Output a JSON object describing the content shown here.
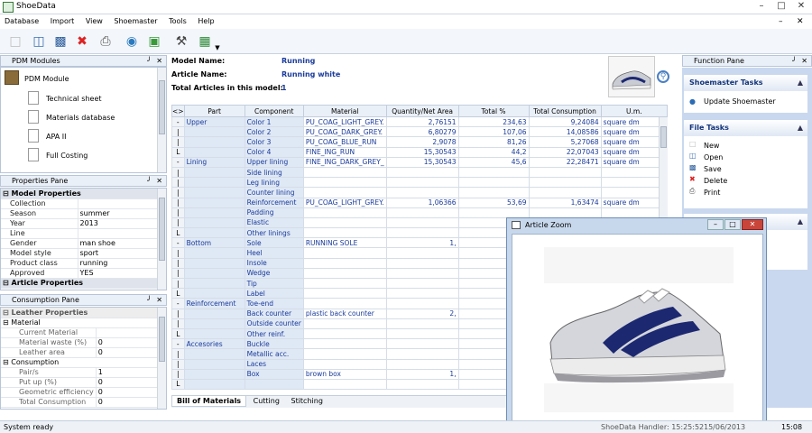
{
  "app": {
    "title": "ShoeData"
  },
  "menu": [
    "Database",
    "Import",
    "View",
    "Shoemaster",
    "Tools",
    "Help"
  ],
  "pdm": {
    "title": "PDM Modules",
    "root": "PDM Module",
    "items": [
      "Technical sheet",
      "Materials database",
      "APA II",
      "Full Costing"
    ]
  },
  "properties": {
    "title": "Properties Pane",
    "section1": "Model Properties",
    "rows": [
      [
        "Collection",
        ""
      ],
      [
        "Season",
        "summer"
      ],
      [
        "Year",
        "2013"
      ],
      [
        "Line",
        ""
      ],
      [
        "Gender",
        "man shoe"
      ],
      [
        "Model style",
        "sport"
      ],
      [
        "Product class",
        "running"
      ],
      [
        "Approved",
        "YES"
      ]
    ],
    "section2": "Article Properties"
  },
  "consumption": {
    "title": "Consumption Pane",
    "section": "Leather Properties",
    "groups": [
      {
        "name": "Material",
        "rows": [
          [
            "Current Material",
            ""
          ],
          [
            "Material waste (%)",
            "0"
          ],
          [
            "Leather area",
            "0"
          ]
        ]
      },
      {
        "name": "Consumption",
        "rows": [
          [
            "Pair/s",
            "1"
          ],
          [
            "Put up (%)",
            "0"
          ],
          [
            "Geometric efficiency",
            "0"
          ],
          [
            "Total Consumption",
            "0"
          ]
        ]
      }
    ]
  },
  "model": {
    "name_label": "Model Name:",
    "name": "Running",
    "article_label": "Article Name:",
    "article": "Running white",
    "total_label": "Total Articles in this model:",
    "total": "1"
  },
  "bom": {
    "corner": "<>",
    "headers": [
      "Part",
      "Component",
      "Material",
      "Quantity/Net Area",
      "Total %",
      "Total Consumption",
      "U.m."
    ],
    "rows": [
      [
        "-",
        "Upper",
        "Color 1",
        "PU_COAG_LIGHT_GREY.",
        "2,76151",
        "234,63",
        "9,24084",
        "square dm"
      ],
      [
        "|",
        "",
        "Color 2",
        "PU_COAG_DARK_GREY.",
        "6,80279",
        "107,06",
        "14,08586",
        "square dm"
      ],
      [
        "|",
        "",
        "Color 3",
        "PU_COAG_BLUE_RUN",
        "2,9078",
        "81,26",
        "5,27068",
        "square dm"
      ],
      [
        "L",
        "",
        "Color 4",
        "FINE_ING_RUN",
        "15,30543",
        "44,2",
        "22,07043",
        "square dm"
      ],
      [
        "-",
        "Lining",
        "Upper lining",
        "FINE_ING_DARK_GREY_",
        "15,30543",
        "45,6",
        "22,28471",
        "square dm"
      ],
      [
        "|",
        "",
        "Side lining",
        "",
        "",
        "",
        "",
        ""
      ],
      [
        "|",
        "",
        "Leg lining",
        "",
        "",
        "",
        "",
        ""
      ],
      [
        "|",
        "",
        "Counter lining",
        "",
        "",
        "",
        "",
        ""
      ],
      [
        "|",
        "",
        "Reinforcement",
        "PU_COAG_LIGHT_GREY.",
        "1,06366",
        "53,69",
        "1,63474",
        "square dm"
      ],
      [
        "|",
        "",
        "Padding",
        "",
        "",
        "",
        "",
        ""
      ],
      [
        "|",
        "",
        "Elastic",
        "",
        "",
        "",
        "",
        ""
      ],
      [
        "L",
        "",
        "Other linings",
        "",
        "",
        "",
        "",
        ""
      ],
      [
        "-",
        "Bottom",
        "Sole",
        "RUNNING SOLE",
        "1,",
        "",
        "",
        ""
      ],
      [
        "|",
        "",
        "Heel",
        "",
        "",
        "",
        "",
        ""
      ],
      [
        "|",
        "",
        "Insole",
        "",
        "",
        "",
        "",
        ""
      ],
      [
        "|",
        "",
        "Wedge",
        "",
        "",
        "",
        "",
        ""
      ],
      [
        "|",
        "",
        "Tip",
        "",
        "",
        "",
        "",
        ""
      ],
      [
        "L",
        "",
        "Label",
        "",
        "",
        "",
        "",
        ""
      ],
      [
        "-",
        "Reinforcement",
        "Toe-end",
        "",
        "",
        "",
        "",
        ""
      ],
      [
        "|",
        "",
        "Back counter",
        "plastic back counter",
        "2,",
        "",
        "",
        ""
      ],
      [
        "|",
        "",
        "Outside counter",
        "",
        "",
        "",
        "",
        ""
      ],
      [
        "L",
        "",
        "Other reinf.",
        "",
        "",
        "",
        "",
        ""
      ],
      [
        "-",
        "Accesories",
        "Buckle",
        "",
        "",
        "",
        "",
        ""
      ],
      [
        "|",
        "",
        "Metallic acc.",
        "",
        "",
        "",
        "",
        ""
      ],
      [
        "|",
        "",
        "Laces",
        "",
        "",
        "",
        "",
        ""
      ],
      [
        "|",
        "",
        "Box",
        "brown box",
        "1,",
        "",
        "",
        ""
      ],
      [
        "L",
        "",
        "",
        "",
        "",
        "",
        "",
        ""
      ]
    ]
  },
  "tabs": [
    "Bill of Materials",
    "Cutting",
    "Stitching"
  ],
  "function_pane": {
    "title": "Function Pane",
    "shoemaster_title": "Shoemaster Tasks",
    "shoemaster_items": [
      "Update Shoemaster"
    ],
    "file_title": "File Tasks",
    "file_items": [
      "New",
      "Open",
      "Save",
      "Delete",
      "Print"
    ]
  },
  "zoom": {
    "title": "Article Zoom"
  },
  "status": {
    "left": "System ready",
    "mid1": "ShoeData Handler: 15:25:52",
    "mid2": "15/06/2013",
    "time": "15:08"
  },
  "colors": {
    "accent": "#13357a",
    "value_blue": "#1a3b9a",
    "pane_bg": "#c9d8ee"
  }
}
